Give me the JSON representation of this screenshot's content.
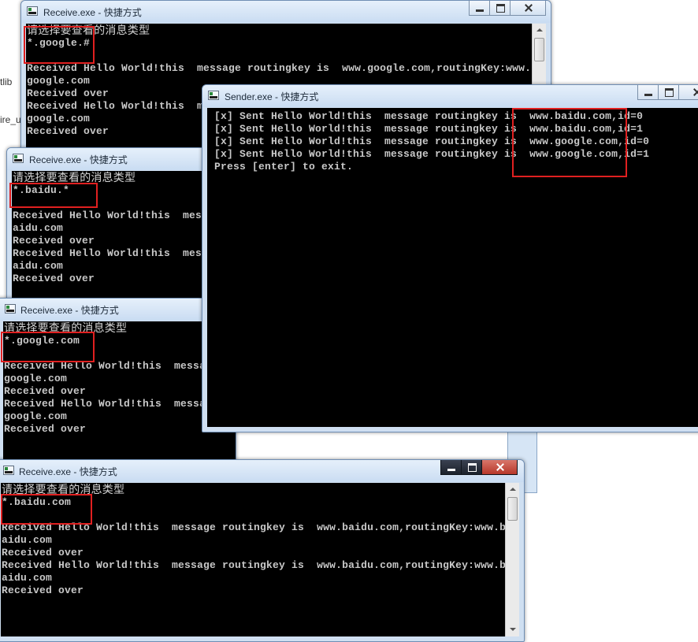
{
  "background": {
    "fragments": [
      "tlib",
      "ire_u"
    ]
  },
  "windows": [
    {
      "id": "receive-google-hash",
      "title": "Receive.exe - 快捷方式",
      "lines": [
        "请选择要查看的消息类型",
        "*.google.#",
        "",
        "Received Hello World!this  message routingkey is  www.google.com,routingKey:www.",
        "google.com",
        "Received over",
        "Received Hello World!this  message routingkey is  www.google.com,routingKey:www.",
        "google.com",
        "Received over"
      ]
    },
    {
      "id": "receive-baidu-star",
      "title": "Receive.exe - 快捷方式",
      "lines": [
        "请选择要查看的消息类型",
        "*.baidu.*",
        "",
        "Received Hello World!this  message routingkey is  www.baidu.com,routingKey:www.b",
        "aidu.com",
        "Received over",
        "Received Hello World!this  message routingkey is  www.baidu.com,routingKey:www.b",
        "aidu.com",
        "Received over"
      ]
    },
    {
      "id": "receive-google-com",
      "title": "Receive.exe - 快捷方式",
      "lines": [
        "请选择要查看的消息类型",
        "*.google.com",
        "",
        "Received Hello World!this  message routingkey is  www.google.com,routingKey:www.",
        "google.com",
        "Received over",
        "Received Hello World!this  message routingkey is  www.google.com,routingKey:www.",
        "google.com",
        "Received over"
      ]
    },
    {
      "id": "sender",
      "title": "Sender.exe - 快捷方式",
      "lines": [
        " [x] Sent Hello World!this  message routingkey is  www.baidu.com,id=0",
        " [x] Sent Hello World!this  message routingkey is  www.baidu.com,id=1",
        " [x] Sent Hello World!this  message routingkey is  www.google.com,id=0",
        " [x] Sent Hello World!this  message routingkey is  www.google.com,id=1",
        " Press [enter] to exit."
      ]
    },
    {
      "id": "receive-baidu-com",
      "title": "Receive.exe - 快捷方式",
      "lines": [
        "请选择要查看的消息类型",
        "*.baidu.com",
        "",
        "Received Hello World!this  message routingkey is  www.baidu.com,routingKey:www.b",
        "aidu.com",
        "Received over",
        "Received Hello World!this  message routingkey is  www.baidu.com,routingKey:www.b",
        "aidu.com",
        "Received over"
      ]
    }
  ],
  "colors": {
    "console_bg": "#000000",
    "console_text": "#c8c8c8",
    "highlight_box": "#e02020",
    "titlebar": "#d6e5f5"
  }
}
